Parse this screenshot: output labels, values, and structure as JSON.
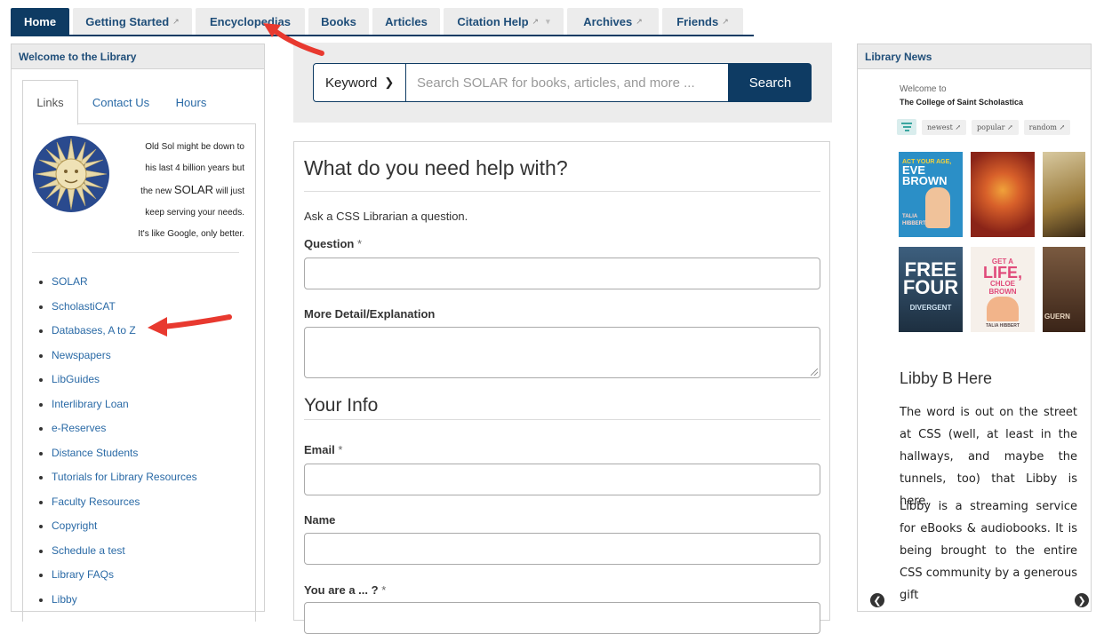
{
  "nav": {
    "tabs": [
      {
        "label": "Home"
      },
      {
        "label": "Getting Started",
        "external": "↗"
      },
      {
        "label": "Encyclopedias"
      },
      {
        "label": "Books"
      },
      {
        "label": "Articles"
      },
      {
        "label": "Citation Help",
        "external": "↗"
      },
      {
        "label": "Archives",
        "external": "↗"
      },
      {
        "label": "Friends",
        "external": "↗"
      }
    ],
    "active": "Home"
  },
  "welcome": {
    "title": "Welcome to the Library",
    "tabs": [
      "Links",
      "Contact Us",
      "Hours"
    ],
    "active_tab": "Links",
    "intro": {
      "line1": "Old Sol might be down to",
      "line2": "his last 4 billion years but",
      "line3a": "the new ",
      "line3b": "SOLAR",
      "line3c": " will just",
      "line4": "keep serving your needs.",
      "line5": "It's like Google, only better."
    },
    "links": [
      "SOLAR",
      "ScholastiCAT",
      "Databases, A to Z",
      "Newspapers",
      "LibGuides",
      "Interlibrary Loan",
      "e-Reserves",
      "Distance Students",
      "Tutorials for Library Resources",
      "Faculty Resources",
      "Copyright",
      "Schedule a test",
      "Library FAQs",
      "Libby"
    ]
  },
  "search": {
    "scope": "Keyword",
    "placeholder": "Search SOLAR for books, articles, and more ...",
    "button": "Search"
  },
  "help": {
    "title": "What do you need help with?",
    "subtitle": "Ask a CSS Librarian a question.",
    "question_label": "Question",
    "detail_label": "More Detail/Explanation",
    "info_title": "Your Info",
    "email_label": "Email",
    "name_label": "Name",
    "role_label": "You are a ... ?",
    "required_mark": "*"
  },
  "news": {
    "title": "Library News",
    "welcome": "Welcome to",
    "college": "The College of Saint Scholastica",
    "filters": [
      "newest ↗",
      "popular ↗",
      "random ↗"
    ],
    "covers": [
      {
        "lines": [
          "ACT YOUR AGE,",
          "EVE",
          "BROWN",
          "TALIA",
          "HIBBERT"
        ],
        "bg": "#2b8fc7"
      },
      {
        "lines": [],
        "bg": "#c8452a"
      },
      {
        "lines": [],
        "bg": "#b89a5a"
      },
      {
        "lines": [
          "FREE",
          "FOUR",
          "DIVERGENT"
        ],
        "bg": "#2e4a63"
      },
      {
        "lines": [
          "GET A",
          "LIFE,",
          "CHLOE",
          "BROWN",
          "TALIA HIBBERT"
        ],
        "bg": "#f3eee8"
      },
      {
        "lines": [
          "GUERN"
        ],
        "bg": "#5a4030"
      }
    ],
    "post_title": "Libby B Here",
    "para1": "The word is out on the street at CSS (well, at least in the hallways, and maybe the tunnels, too) that Libby is here.",
    "para2": "Libby is a streaming service for eBooks & audiobooks. It is being brought to the entire CSS community by a generous gift"
  },
  "colors": {
    "nav_active": "#0e3b63",
    "link": "#2a6aa6",
    "annotation": "#e8392f"
  }
}
